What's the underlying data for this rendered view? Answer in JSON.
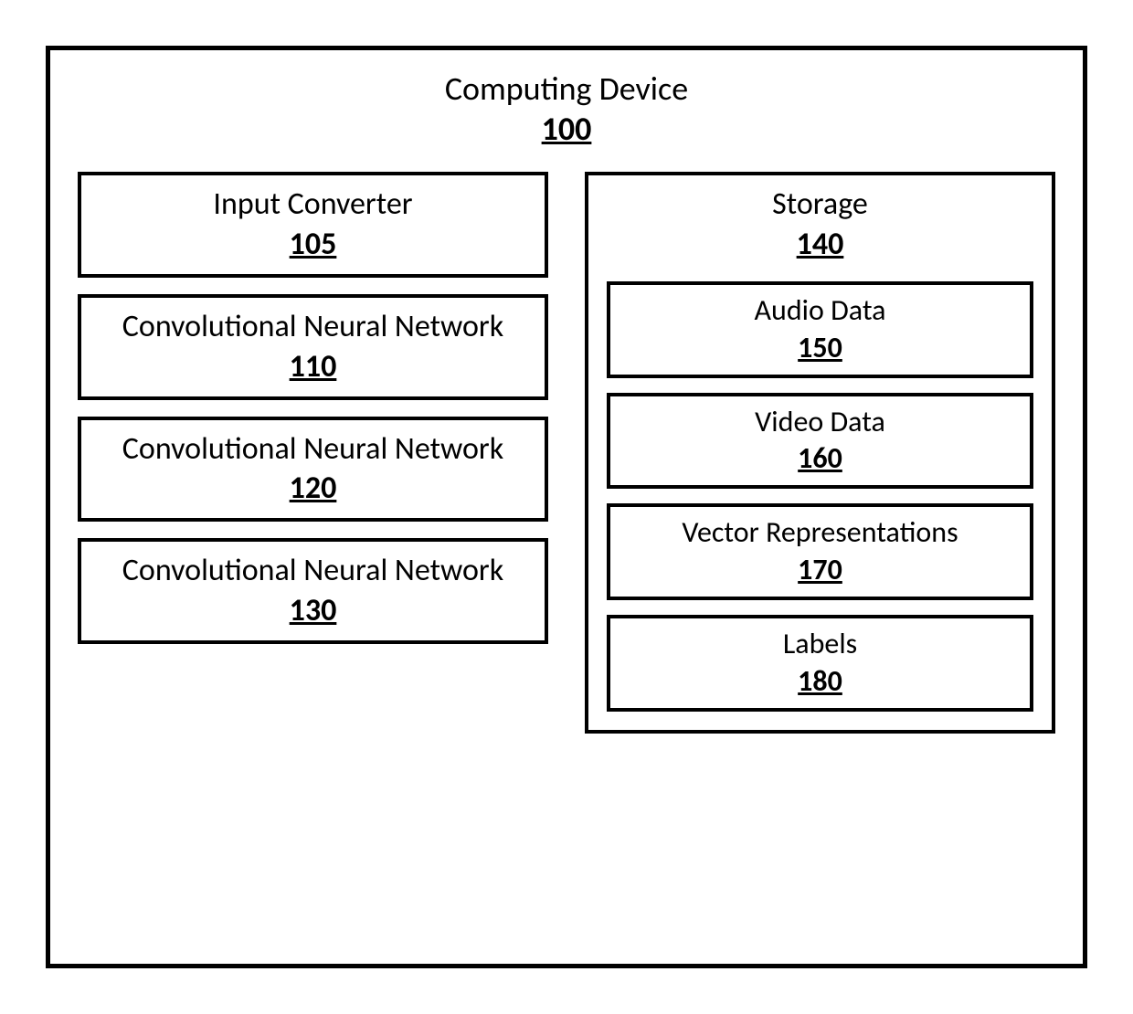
{
  "outer": {
    "label": "Computing Device",
    "num": "100"
  },
  "left": [
    {
      "label": "Input Converter",
      "num": "105"
    },
    {
      "label": "Convolutional Neural Network",
      "num": "110"
    },
    {
      "label": "Convolutional Neural Network",
      "num": "120"
    },
    {
      "label": "Convolutional Neural Network",
      "num": "130"
    }
  ],
  "storage": {
    "label": "Storage",
    "num": "140",
    "items": [
      {
        "label": "Audio Data",
        "num": "150"
      },
      {
        "label": "Video Data",
        "num": "160"
      },
      {
        "label": "Vector Representations",
        "num": "170"
      },
      {
        "label": "Labels",
        "num": "180"
      }
    ]
  }
}
